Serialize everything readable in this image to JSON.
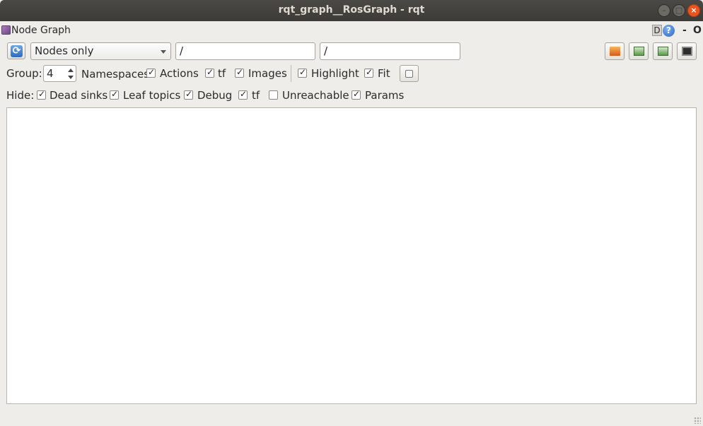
{
  "window": {
    "title": "rqt_graph__RosGraph - rqt",
    "controls": [
      "minimize",
      "maximize",
      "close"
    ]
  },
  "plugin": {
    "title": "Node Graph",
    "dock_d": "D",
    "help": "?",
    "minimize": "-",
    "close": "O"
  },
  "toolbar": {
    "graph_mode": "Nodes only",
    "filter_1": "/",
    "filter_2": "/"
  },
  "options": {
    "group_label": "Group:",
    "group_value": "4",
    "namespaces_label": "Namespaces",
    "actions": {
      "label": "Actions",
      "checked": true
    },
    "tf": {
      "label": "tf",
      "checked": true
    },
    "images": {
      "label": "Images",
      "checked": true
    },
    "highlight": {
      "label": "Highlight",
      "checked": true
    },
    "fit": {
      "label": "Fit",
      "checked": true
    }
  },
  "hide": {
    "label": "Hide:",
    "dead_sinks": {
      "label": "Dead sinks",
      "checked": true
    },
    "leaf_topics": {
      "label": "Leaf topics",
      "checked": true
    },
    "debug": {
      "label": "Debug",
      "checked": true
    },
    "tf": {
      "label": "tf",
      "checked": true
    },
    "unreachable": {
      "label": "Unreachable",
      "checked": false
    },
    "params": {
      "label": "Params",
      "checked": true
    }
  },
  "colors": {
    "titlebar": "#3c3b37",
    "close_button": "#e95420",
    "background": "#efedea",
    "canvas": "#ffffff"
  }
}
